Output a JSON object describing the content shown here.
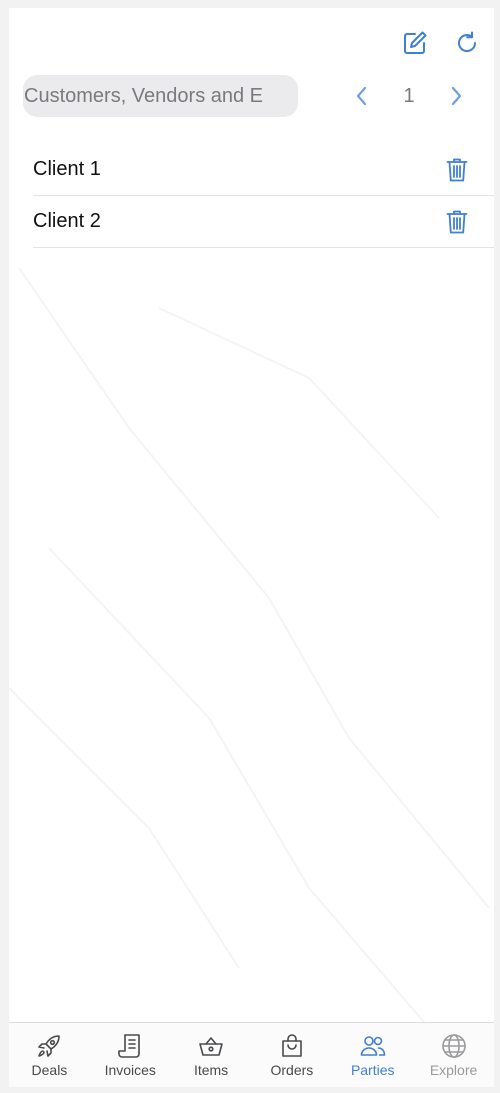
{
  "colors": {
    "accent": "#3f7fd6",
    "icon_neutral": "#4a4a4d",
    "icon_disabled": "#9a9a9e"
  },
  "toolbar": {
    "compose_icon": "compose-icon",
    "refresh_icon": "refresh-icon"
  },
  "search": {
    "placeholder": "Customers, Vendors and E",
    "value": ""
  },
  "pager": {
    "page": "1",
    "prev_icon": "chevron-left-icon",
    "next_icon": "chevron-right-icon"
  },
  "parties": {
    "items": [
      {
        "label": "Client 1",
        "icon": "trash-icon"
      },
      {
        "label": "Client 2",
        "icon": "trash-icon"
      }
    ]
  },
  "tabbar": {
    "tabs": [
      {
        "label": "Deals",
        "icon": "rocket-icon",
        "state": "normal"
      },
      {
        "label": "Invoices",
        "icon": "receipt-icon",
        "state": "normal"
      },
      {
        "label": "Items",
        "icon": "basket-icon",
        "state": "normal"
      },
      {
        "label": "Orders",
        "icon": "shopping-bag-icon",
        "state": "normal"
      },
      {
        "label": "Parties",
        "icon": "people-icon",
        "state": "active"
      },
      {
        "label": "Explore",
        "icon": "globe-icon",
        "state": "disabled"
      }
    ]
  }
}
